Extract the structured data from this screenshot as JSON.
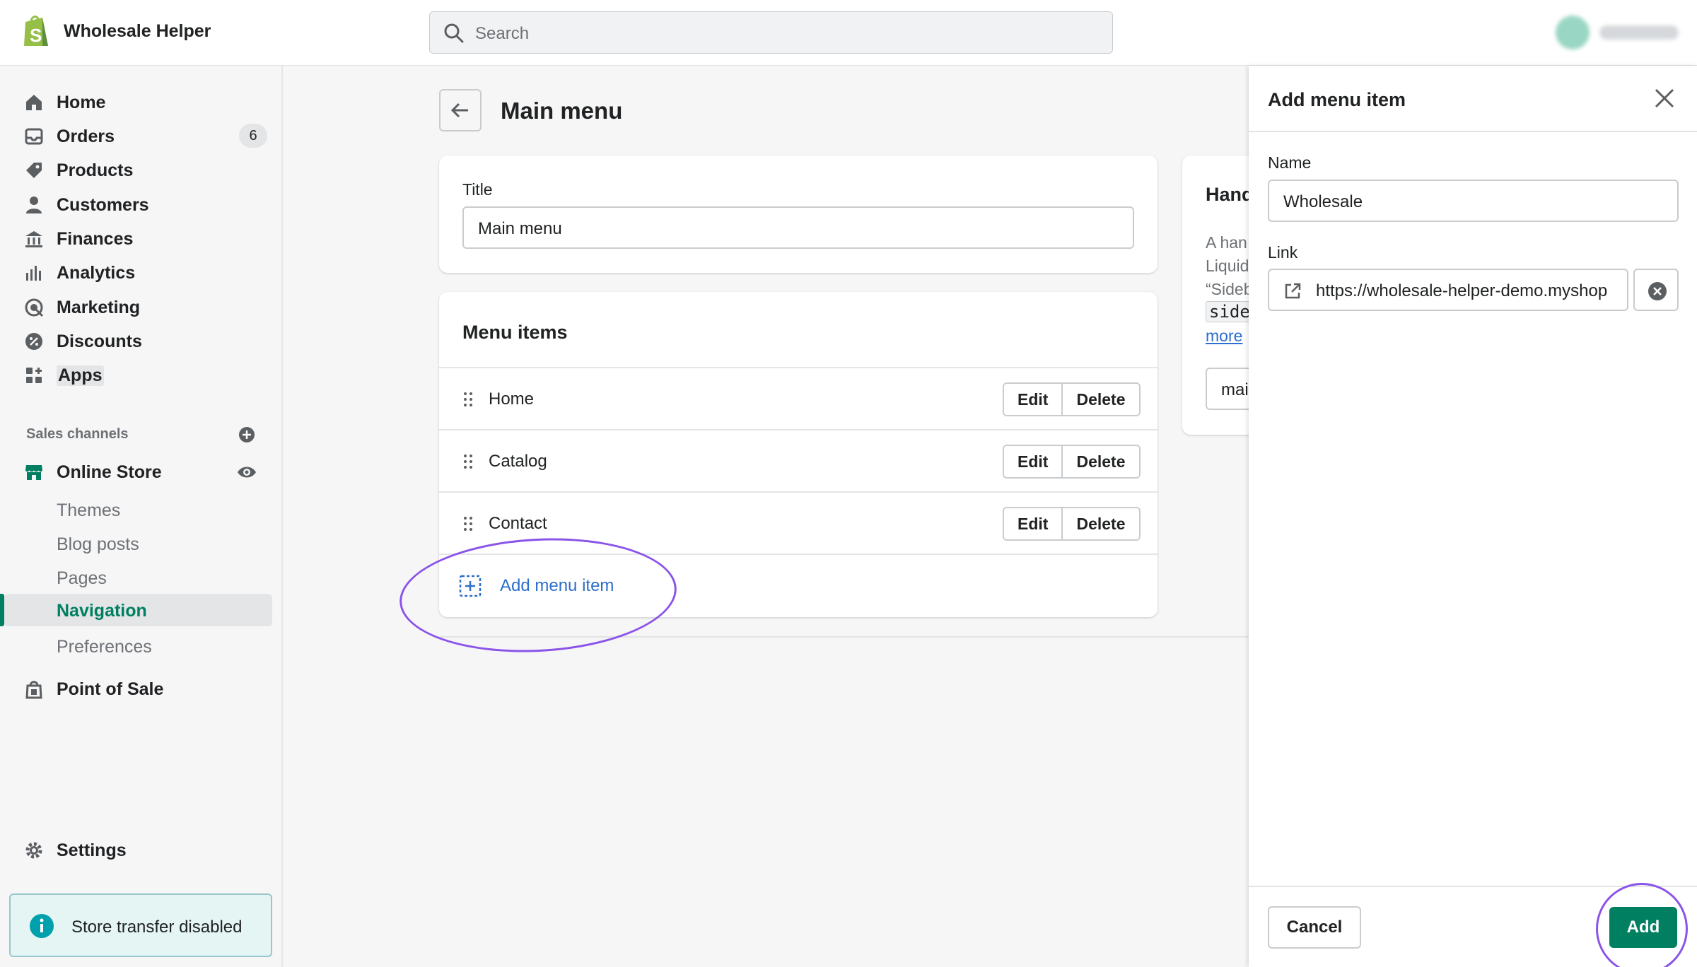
{
  "header": {
    "store_name": "Wholesale Helper",
    "search_placeholder": "Search"
  },
  "sidebar": {
    "items": [
      {
        "label": "Home",
        "icon": "home-icon"
      },
      {
        "label": "Orders",
        "icon": "orders-icon",
        "badge": "6"
      },
      {
        "label": "Products",
        "icon": "tag-icon"
      },
      {
        "label": "Customers",
        "icon": "person-icon"
      },
      {
        "label": "Finances",
        "icon": "bank-icon"
      },
      {
        "label": "Analytics",
        "icon": "bar-chart-icon"
      },
      {
        "label": "Marketing",
        "icon": "target-icon"
      },
      {
        "label": "Discounts",
        "icon": "discount-icon"
      },
      {
        "label": "Apps",
        "icon": "apps-icon"
      }
    ],
    "sales_channels_label": "Sales channels",
    "online_store": {
      "label": "Online Store",
      "icon": "store-icon"
    },
    "sub_items": [
      "Themes",
      "Blog posts",
      "Pages",
      "Navigation",
      "Preferences"
    ],
    "active_sub_item": "Navigation",
    "point_of_sale": "Point of Sale",
    "settings": "Settings",
    "store_transfer": "Store transfer disabled"
  },
  "main": {
    "title": "Main menu",
    "title_card": {
      "label": "Title",
      "value": "Main menu"
    },
    "menu_items_card": {
      "heading": "Menu items",
      "rows": [
        {
          "label": "Home"
        },
        {
          "label": "Catalog"
        },
        {
          "label": "Contact"
        }
      ],
      "edit_label": "Edit",
      "delete_label": "Delete",
      "add_label": "Add menu item"
    },
    "handle_card": {
      "heading_partial": "Hand",
      "lines": [
        "A han",
        "Liquid",
        "“Sideb"
      ],
      "code_partial": "side",
      "more_link": "more",
      "input_partial": "mai"
    }
  },
  "drawer": {
    "title": "Add menu item",
    "name_label": "Name",
    "name_value": "Wholesale",
    "link_label": "Link",
    "link_value": "https://wholesale-helper-demo.myshop",
    "cancel_label": "Cancel",
    "add_label": "Add"
  },
  "colors": {
    "accent_green": "#008060",
    "link_blue": "#2c6ecb",
    "annotation_purple": "#8b54e8"
  }
}
